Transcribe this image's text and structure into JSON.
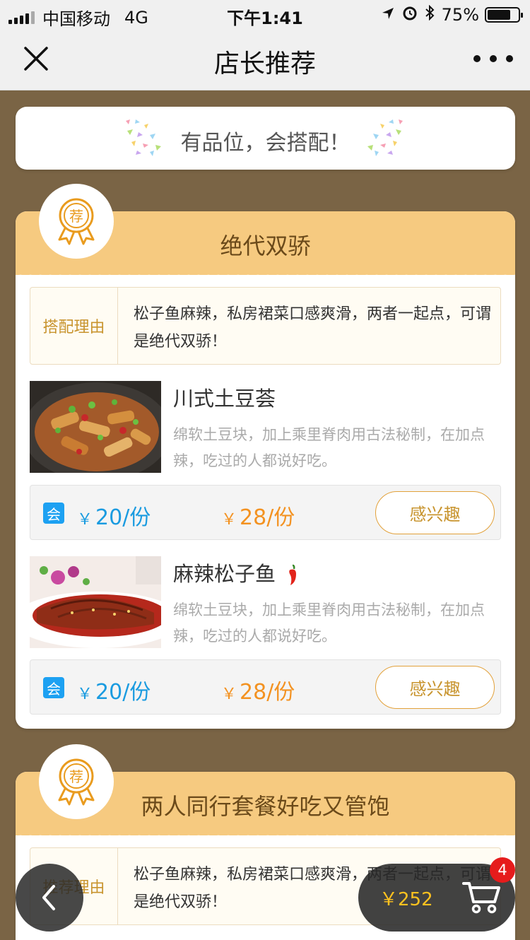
{
  "status_bar": {
    "carrier": "中国移动",
    "network": "4G",
    "time": "下午1:41",
    "battery": "75%",
    "battery_level": 0.75
  },
  "nav": {
    "title": "店长推荐"
  },
  "slogan": "有品位，会搭配！",
  "cards": [
    {
      "badge_char": "荐",
      "title": "绝代双骄",
      "reason_label": "搭配理由",
      "reason_text": "松子鱼麻辣，私房裙菜口感爽滑，两者一起点，可谓是绝代双骄！",
      "dishes": [
        {
          "name": "川式土豆荟",
          "spicy": false,
          "desc": "绵软土豆块，加上乘里脊肉用古法秘制，在加点辣，吃过的人都说好吃。",
          "member_price": "20/份",
          "price": "28/份",
          "interest_label": "感兴趣"
        },
        {
          "name": "麻辣松子鱼",
          "spicy": true,
          "desc": "绵软土豆块，加上乘里脊肉用古法秘制，在加点辣，吃过的人都说好吃。",
          "member_price": "20/份",
          "price": "28/份",
          "interest_label": "感兴趣"
        }
      ]
    },
    {
      "badge_char": "荐",
      "title": "两人同行套餐好吃又管饱",
      "reason_label": "推荐理由",
      "reason_text": "松子鱼麻辣，私房裙菜口感爽滑，两者一起点，可谓是绝代双骄！"
    }
  ],
  "vip_label": "会",
  "currency": "￥",
  "cart": {
    "total": "￥252",
    "count": "4"
  },
  "colors": {
    "accent": "#f6ca80",
    "member_price": "#1a9be0",
    "price": "#f39221",
    "background": "#7a6445"
  }
}
